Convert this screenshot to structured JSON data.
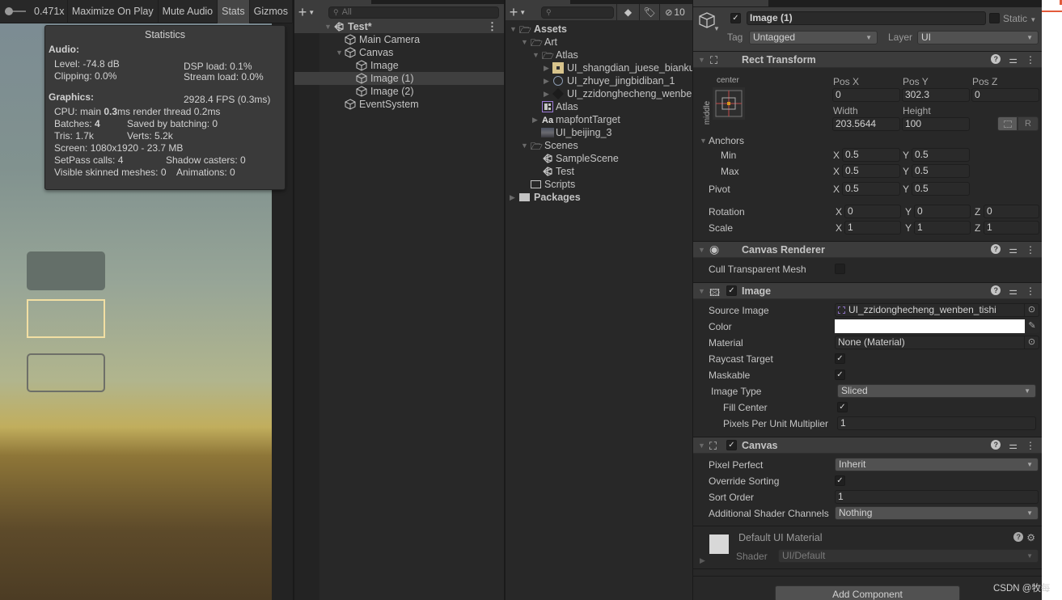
{
  "game_toolbar": {
    "scale_value": "0.471x",
    "maximize_on_play": "Maximize On Play",
    "mute_audio": "Mute Audio",
    "stats": "Stats",
    "gizmos": "Gizmos"
  },
  "statistics": {
    "title": "Statistics",
    "audio_header": "Audio:",
    "level": "Level: -74.8 dB",
    "clipping": "Clipping: 0.0%",
    "dsp_load": "DSP load: 0.1%",
    "stream_load": "Stream load: 0.0%",
    "graphics_header": "Graphics:",
    "fps": "2928.4 FPS (0.3ms)",
    "cpu_prefix": "CPU: main ",
    "cpu_main": "0.3",
    "cpu_suffix": "ms  render thread 0.2ms",
    "batches_prefix": "Batches: ",
    "batches": "4",
    "saved_by_batching": "Saved by batching: 0",
    "tris": "Tris: 1.7k",
    "verts": "Verts: 5.2k",
    "screen": "Screen: 1080x1920 - 23.7 MB",
    "setpass": "SetPass calls: 4",
    "shadow_casters": "Shadow casters: 0",
    "skinned": "Visible skinned meshes: 0",
    "animations": "Animations: 0"
  },
  "hierarchy": {
    "search_placeholder": "All",
    "scene": "Test*",
    "items": [
      {
        "label": "Main Camera"
      },
      {
        "label": "Canvas"
      },
      {
        "label": "Image"
      },
      {
        "label": "Image (1)"
      },
      {
        "label": "Image (2)"
      },
      {
        "label": "EventSystem"
      }
    ]
  },
  "project": {
    "hidden_count": "10",
    "items": [
      {
        "label": "Assets"
      },
      {
        "label": "Art"
      },
      {
        "label": "Atlas"
      },
      {
        "label": "UI_shangdian_juese_bianku"
      },
      {
        "label": "UI_zhuye_jingbidiban_1"
      },
      {
        "label": "UI_zzidonghecheng_wenbe"
      },
      {
        "label": "Atlas"
      },
      {
        "label": "mapfontTarget"
      },
      {
        "label": "UI_beijing_3"
      },
      {
        "label": "Scenes"
      },
      {
        "label": "SampleScene"
      },
      {
        "label": "Test"
      },
      {
        "label": "Scripts"
      },
      {
        "label": "Packages"
      }
    ]
  },
  "inspector": {
    "object_name": "Image (1)",
    "active": true,
    "static_label": "Static",
    "tag_label": "Tag",
    "tag_value": "Untagged",
    "layer_label": "Layer",
    "layer_value": "UI",
    "rect_transform": {
      "title": "Rect Transform",
      "anchor_preset_h": "center",
      "anchor_preset_v": "middle",
      "pos_x_label": "Pos X",
      "pos_x": "0",
      "pos_y_label": "Pos Y",
      "pos_y": "302.3",
      "pos_z_label": "Pos Z",
      "pos_z": "0",
      "width_label": "Width",
      "width": "203.5644",
      "height_label": "Height",
      "height": "100",
      "r_button": "R",
      "anchors_label": "Anchors",
      "min_label": "Min",
      "min_x": "0.5",
      "min_y": "0.5",
      "max_label": "Max",
      "max_x": "0.5",
      "max_y": "0.5",
      "pivot_label": "Pivot",
      "pivot_x": "0.5",
      "pivot_y": "0.5",
      "rotation_label": "Rotation",
      "rot_x": "0",
      "rot_y": "0",
      "rot_z": "0",
      "scale_label": "Scale",
      "scale_x": "1",
      "scale_y": "1",
      "scale_z": "1",
      "x": "X",
      "y": "Y",
      "z": "Z"
    },
    "canvas_renderer": {
      "title": "Canvas Renderer",
      "cull_label": "Cull Transparent Mesh",
      "cull_value": false
    },
    "image": {
      "title": "Image",
      "enabled": true,
      "source_image_label": "Source Image",
      "source_image": "UI_zzidonghecheng_wenben_tishi",
      "color_label": "Color",
      "color_value": "#ffffff",
      "material_label": "Material",
      "material": "None (Material)",
      "raycast_label": "Raycast Target",
      "raycast": true,
      "maskable_label": "Maskable",
      "maskable": true,
      "image_type_label": "Image Type",
      "image_type": "Sliced",
      "fill_center_label": "Fill Center",
      "fill_center": true,
      "ppu_label": "Pixels Per Unit Multiplier",
      "ppu": "1"
    },
    "canvas": {
      "title": "Canvas",
      "enabled": true,
      "pixel_perfect_label": "Pixel Perfect",
      "pixel_perfect": "Inherit",
      "override_sorting_label": "Override Sorting",
      "override_sorting": true,
      "sort_order_label": "Sort Order",
      "sort_order": "1",
      "shader_channels_label": "Additional Shader Channels",
      "shader_channels": "Nothing"
    },
    "material": {
      "name": "Default UI Material",
      "shader_label": "Shader",
      "shader": "UI/Default"
    },
    "add_component": "Add Component"
  },
  "watermark": "CSDN @牧每"
}
